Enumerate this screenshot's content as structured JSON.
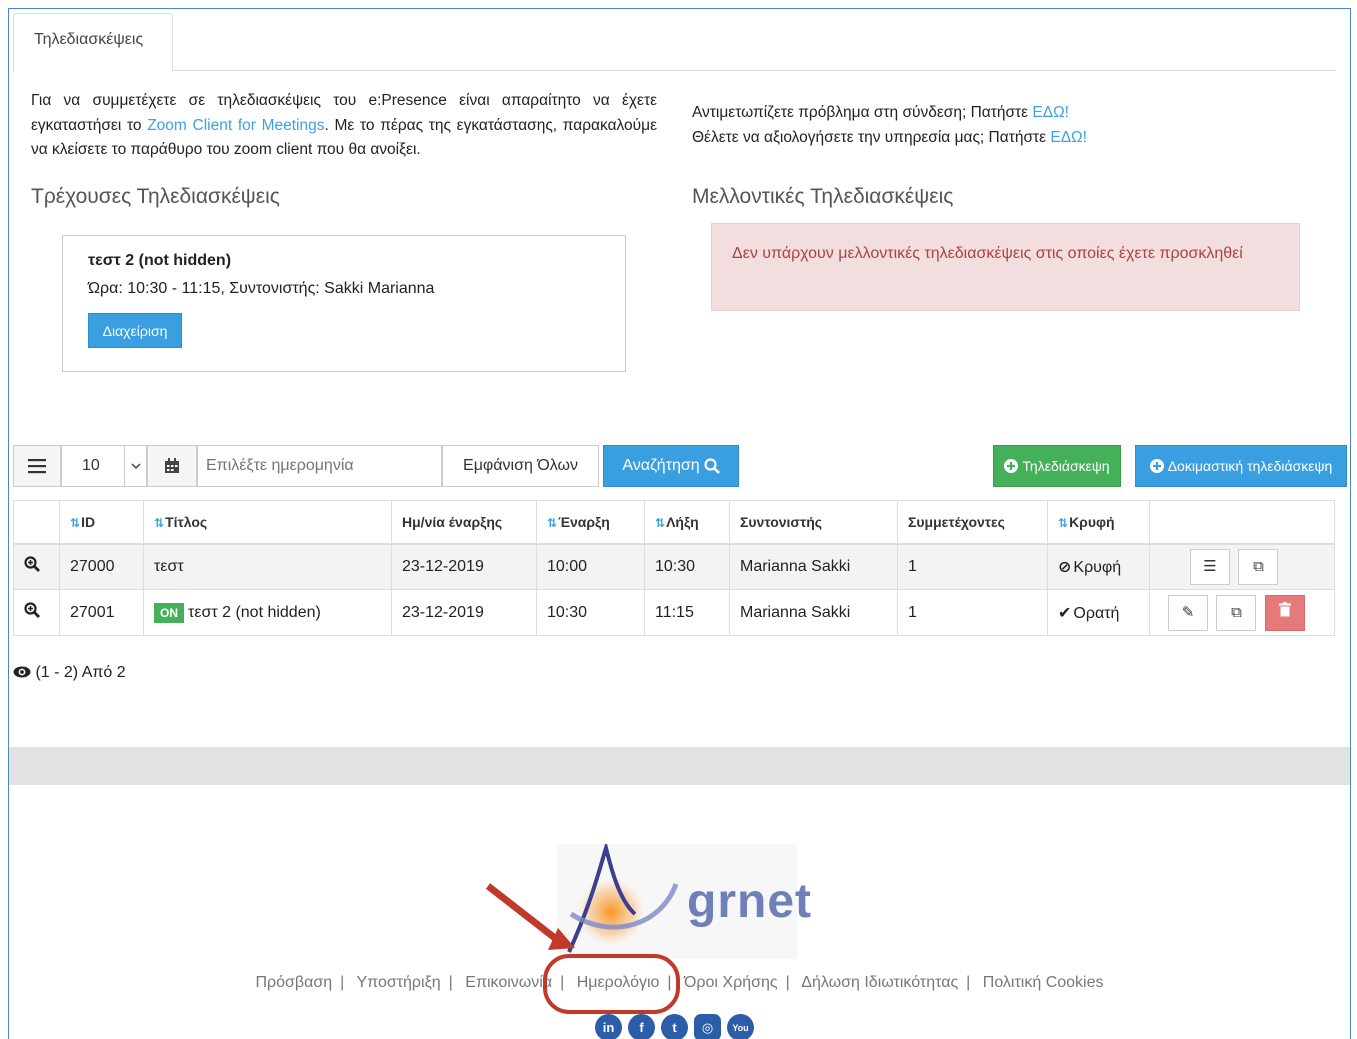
{
  "tab": {
    "label": "Τηλεδιασκέψεις"
  },
  "intro": {
    "part1": "Για να συμμετέχετε σε τηλεδιασκέψεις του e:Presence είναι απαραίτητο να έχετε εγκαταστήσει το ",
    "link": "Zoom Client for Meetings",
    "part2": ". Με το πέρας της εγκατάστασης, παρακαλούμε να κλείσετε το παράθυρο του zoom client που θα ανοίξει."
  },
  "help": {
    "line1": "Αντιμετωπίζετε πρόβλημα στη σύνδεση; Πατήστε ",
    "line1_link": "ΕΔΩ!",
    "line2": "Θέλετε να αξιολογήσετε την υπηρεσία μας; Πατήστε ",
    "line2_link": "ΕΔΩ!"
  },
  "current": {
    "heading": "Τρέχουσες Τηλεδιασκέψεις",
    "title": "τεστ 2 (not hidden)",
    "meta": "Ώρα: 10:30 - 11:15, Συντονιστής: Sakki Marianna",
    "manage_label": "Διαχείριση"
  },
  "future": {
    "heading": "Μελλοντικές Τηλεδιασκέψεις",
    "message": "Δεν υπάρχουν μελλοντικές τηλεδιασκέψεις στις οποίες έχετε προσκληθεί"
  },
  "toolbar": {
    "page_size": "10",
    "date_placeholder": "Επιλέξτε ημερομηνία",
    "show_all": "Εμφάνιση Όλων",
    "search": "Αναζήτηση",
    "new_conf": "Τηλεδιάσκεψη",
    "test_conf": "Δοκιμαστική τηλεδιάσκεψη"
  },
  "table": {
    "headers": [
      "ID",
      "Τίτλος",
      "Ημ/νία έναρξης",
      "Έναρξη",
      "Λήξη",
      "Συντονιστής",
      "Συμμετέχοντες",
      "Κρυφή"
    ],
    "rows": [
      {
        "id": "27000",
        "title": "τεστ",
        "badge": "",
        "date": "23-12-2019",
        "start": "10:00",
        "end": "10:30",
        "coordinator": "Marianna Sakki",
        "participants": "1",
        "hidden": "Κρυφή"
      },
      {
        "id": "27001",
        "title": "τεστ 2 (not hidden)",
        "badge": "ON",
        "date": "23-12-2019",
        "start": "10:30",
        "end": "11:15",
        "coordinator": "Marianna Sakki",
        "participants": "1",
        "hidden": "Ορατή"
      }
    ]
  },
  "paging": {
    "text": "(1 - 2) Από 2"
  },
  "logo": {
    "text": "grnet"
  },
  "footer": {
    "links": [
      "Πρόσβαση",
      "Υποστήριξη",
      "Επικοινωνία",
      "Ημερολόγιο",
      "Όροι Χρήσης",
      "Δήλωση Ιδιωτικότητας",
      "Πολιτική Cookies"
    ],
    "social": [
      "linkedin-icon",
      "facebook-icon",
      "twitter-icon",
      "instagram-icon",
      "youtube-icon"
    ]
  },
  "colors": {
    "accent": "#3a9fe0",
    "success": "#44b05a",
    "danger": "#e67a7a",
    "annotation": "#c0392b"
  }
}
